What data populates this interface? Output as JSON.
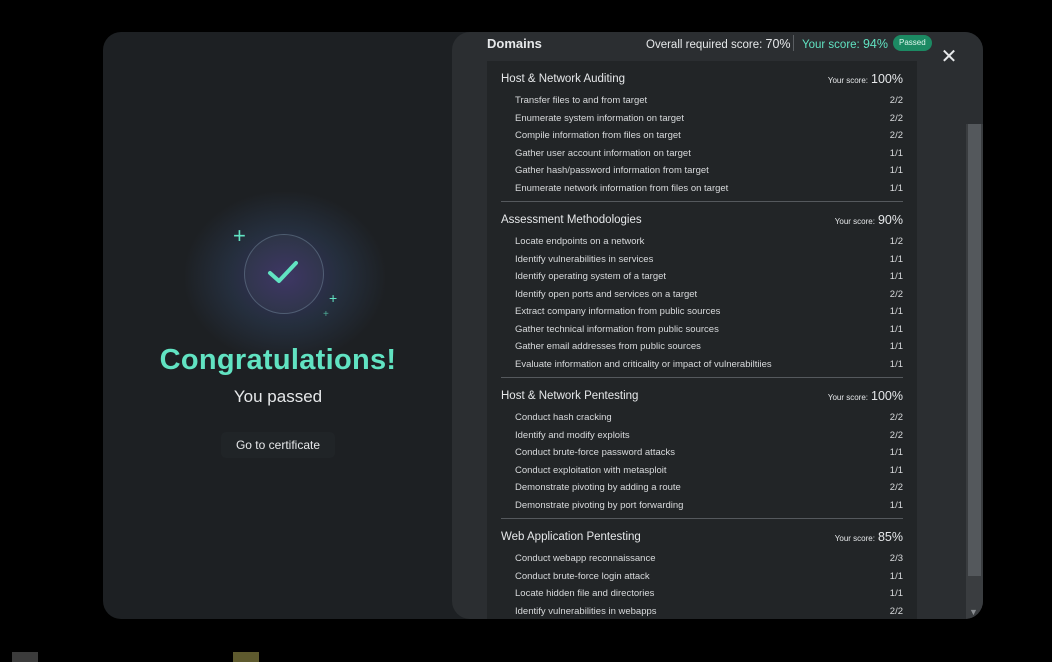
{
  "congrats": {
    "title": "Congratulations!",
    "subtitle": "You passed",
    "certificate_button": "Go to certificate"
  },
  "header": {
    "title": "Domains",
    "overall_label": "Overall required score:",
    "overall_value": "70%",
    "your_label": "Your score:",
    "your_value": "94%",
    "badge": "Passed",
    "close_icon": "close-icon"
  },
  "domains": [
    {
      "name": "Host & Network Auditing",
      "score_label": "Your score:",
      "score": "100%",
      "tasks": [
        {
          "name": "Transfer files to and from target",
          "score": "2/2"
        },
        {
          "name": "Enumerate system information on target",
          "score": "2/2"
        },
        {
          "name": "Compile information from files on target",
          "score": "2/2"
        },
        {
          "name": "Gather user account information on target",
          "score": "1/1"
        },
        {
          "name": "Gather hash/password information from target",
          "score": "1/1"
        },
        {
          "name": "Enumerate network information from files on target",
          "score": "1/1"
        }
      ]
    },
    {
      "name": "Assessment Methodologies",
      "score_label": "Your score:",
      "score": "90%",
      "tasks": [
        {
          "name": "Locate endpoints on a network",
          "score": "1/2"
        },
        {
          "name": "Identify vulnerabilities in services",
          "score": "1/1"
        },
        {
          "name": "Identify operating system of a target",
          "score": "1/1"
        },
        {
          "name": "Identify open ports and services on a target",
          "score": "2/2"
        },
        {
          "name": "Extract company information from public sources",
          "score": "1/1"
        },
        {
          "name": "Gather technical information from public sources",
          "score": "1/1"
        },
        {
          "name": "Gather email addresses from public sources",
          "score": "1/1"
        },
        {
          "name": "Evaluate information and criticality or impact of vulnerabiltiies",
          "score": "1/1"
        }
      ]
    },
    {
      "name": "Host & Network Pentesting",
      "score_label": "Your score:",
      "score": "100%",
      "tasks": [
        {
          "name": "Conduct hash cracking",
          "score": "2/2"
        },
        {
          "name": "Identify and modify exploits",
          "score": "2/2"
        },
        {
          "name": "Conduct brute-force password attacks",
          "score": "1/1"
        },
        {
          "name": "Conduct exploitation with metasploit",
          "score": "1/1"
        },
        {
          "name": "Demonstrate pivoting by adding a route",
          "score": "2/2"
        },
        {
          "name": "Demonstrate pivoting by port forwarding",
          "score": "1/1"
        }
      ]
    },
    {
      "name": "Web Application Pentesting",
      "score_label": "Your score:",
      "score": "85%",
      "tasks": [
        {
          "name": "Conduct webapp reconnaissance",
          "score": "2/3"
        },
        {
          "name": "Conduct brute-force login attack",
          "score": "1/1"
        },
        {
          "name": "Locate hidden file and directories",
          "score": "1/1"
        },
        {
          "name": "Identify vulnerabilities in webapps",
          "score": "2/2"
        }
      ]
    }
  ],
  "colors": {
    "accent": "#61e3c2",
    "badge": "#1c8a63",
    "modal_bg": "#1d2023",
    "panel_bg": "#2b2e31",
    "list_bg": "#222527"
  }
}
